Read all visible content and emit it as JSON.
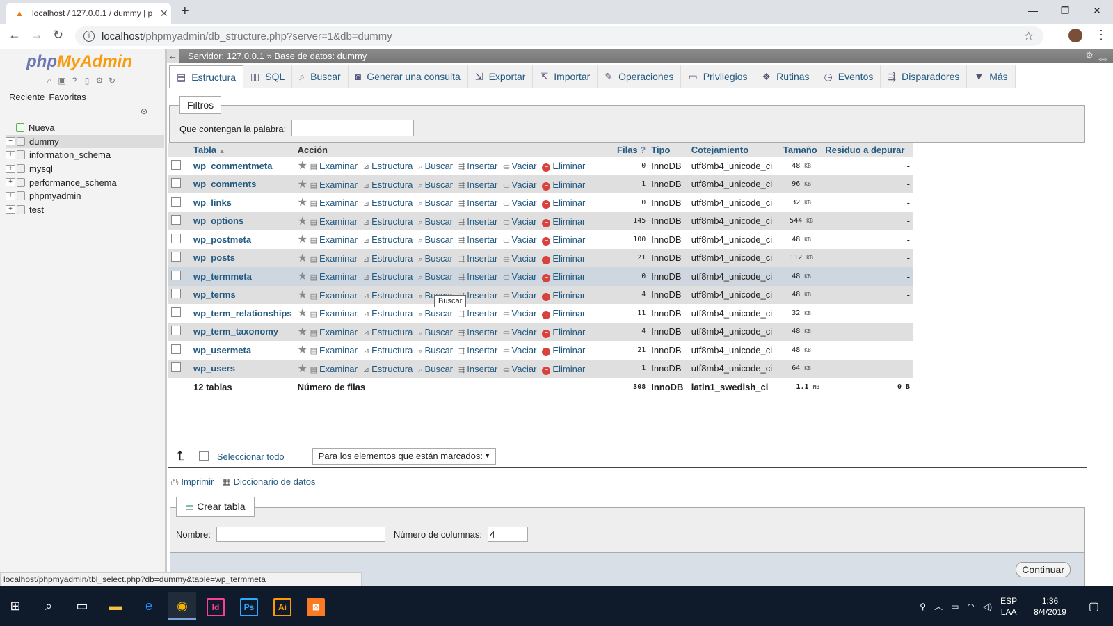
{
  "browser": {
    "tab_title": "localhost / 127.0.0.1 / dummy | p",
    "url_host": "localhost",
    "url_path": "/phpmyadmin/db_structure.php?server=1&db=dummy"
  },
  "sidebar": {
    "logo_php": "php",
    "logo_myadmin": "MyAdmin",
    "tabs": [
      "Reciente",
      "Favoritas"
    ],
    "tree": [
      {
        "label": "Nueva",
        "type": "new"
      },
      {
        "label": "dummy",
        "type": "db",
        "selected": true
      },
      {
        "label": "information_schema",
        "type": "db"
      },
      {
        "label": "mysql",
        "type": "db"
      },
      {
        "label": "performance_schema",
        "type": "db"
      },
      {
        "label": "phpmyadmin",
        "type": "db"
      },
      {
        "label": "test",
        "type": "db"
      }
    ]
  },
  "breadcrumb": {
    "server": "Servidor: 127.0.0.1 »",
    "database": "Base de datos: dummy"
  },
  "tabs": [
    {
      "label": "Estructura",
      "icon": "structure-icon",
      "active": true
    },
    {
      "label": "SQL",
      "icon": "sql-icon"
    },
    {
      "label": "Buscar",
      "icon": "search-icon"
    },
    {
      "label": "Generar una consulta",
      "icon": "query-icon"
    },
    {
      "label": "Exportar",
      "icon": "export-icon"
    },
    {
      "label": "Importar",
      "icon": "import-icon"
    },
    {
      "label": "Operaciones",
      "icon": "wrench-icon"
    },
    {
      "label": "Privilegios",
      "icon": "privileges-icon"
    },
    {
      "label": "Rutinas",
      "icon": "routines-icon"
    },
    {
      "label": "Eventos",
      "icon": "events-icon"
    },
    {
      "label": "Disparadores",
      "icon": "triggers-icon"
    },
    {
      "label": "Más",
      "icon": "more-icon"
    }
  ],
  "filters": {
    "legend": "Filtros",
    "label": "Que contengan la palabra:",
    "value": ""
  },
  "table": {
    "headers": {
      "tabla": "Tabla",
      "accion": "Acción",
      "filas": "Filas",
      "tipo": "Tipo",
      "cotejamiento": "Cotejamiento",
      "tamano": "Tamaño",
      "residuo": "Residuo a depurar"
    },
    "actions": [
      "Examinar",
      "Estructura",
      "Buscar",
      "Insertar",
      "Vaciar",
      "Eliminar"
    ],
    "rows": [
      {
        "name": "wp_commentmeta",
        "rows": "0",
        "type": "InnoDB",
        "collation": "utf8mb4_unicode_ci",
        "size": "48",
        "unit": "KB",
        "overhead": "-"
      },
      {
        "name": "wp_comments",
        "rows": "1",
        "type": "InnoDB",
        "collation": "utf8mb4_unicode_ci",
        "size": "96",
        "unit": "KB",
        "overhead": "-"
      },
      {
        "name": "wp_links",
        "rows": "0",
        "type": "InnoDB",
        "collation": "utf8mb4_unicode_ci",
        "size": "32",
        "unit": "KB",
        "overhead": "-"
      },
      {
        "name": "wp_options",
        "rows": "145",
        "type": "InnoDB",
        "collation": "utf8mb4_unicode_ci",
        "size": "544",
        "unit": "KB",
        "overhead": "-"
      },
      {
        "name": "wp_postmeta",
        "rows": "100",
        "type": "InnoDB",
        "collation": "utf8mb4_unicode_ci",
        "size": "48",
        "unit": "KB",
        "overhead": "-"
      },
      {
        "name": "wp_posts",
        "rows": "21",
        "type": "InnoDB",
        "collation": "utf8mb4_unicode_ci",
        "size": "112",
        "unit": "KB",
        "overhead": "-"
      },
      {
        "name": "wp_termmeta",
        "rows": "0",
        "type": "InnoDB",
        "collation": "utf8mb4_unicode_ci",
        "size": "48",
        "unit": "KB",
        "overhead": "-",
        "highlight": true
      },
      {
        "name": "wp_terms",
        "rows": "4",
        "type": "InnoDB",
        "collation": "utf8mb4_unicode_ci",
        "size": "48",
        "unit": "KB",
        "overhead": "-"
      },
      {
        "name": "wp_term_relationships",
        "rows": "11",
        "type": "InnoDB",
        "collation": "utf8mb4_unicode_ci",
        "size": "32",
        "unit": "KB",
        "overhead": "-"
      },
      {
        "name": "wp_term_taxonomy",
        "rows": "4",
        "type": "InnoDB",
        "collation": "utf8mb4_unicode_ci",
        "size": "48",
        "unit": "KB",
        "overhead": "-"
      },
      {
        "name": "wp_usermeta",
        "rows": "21",
        "type": "InnoDB",
        "collation": "utf8mb4_unicode_ci",
        "size": "48",
        "unit": "KB",
        "overhead": "-"
      },
      {
        "name": "wp_users",
        "rows": "1",
        "type": "InnoDB",
        "collation": "utf8mb4_unicode_ci",
        "size": "64",
        "unit": "KB",
        "overhead": "-"
      }
    ],
    "footer": {
      "count": "12 tablas",
      "label": "Número de filas",
      "rows": "308",
      "type": "InnoDB",
      "collation": "latin1_swedish_ci",
      "size": "1.1",
      "unit": "MB",
      "overhead": "0 B"
    }
  },
  "tooltip": "Buscar",
  "bulk": {
    "select_all": "Seleccionar todo",
    "dropdown": "Para los elementos que están marcados:"
  },
  "links": {
    "print": "Imprimir",
    "dictionary": "Diccionario de datos"
  },
  "create": {
    "legend": "Crear tabla",
    "name_label": "Nombre:",
    "name_value": "",
    "cols_label": "Número de columnas:",
    "cols_value": "4",
    "button": "Continuar"
  },
  "status_url": "localhost/phpmyadmin/tbl_select.php?db=dummy&table=wp_termmeta",
  "taskbar": {
    "lang_top": "ESP",
    "lang_bottom": "LAA",
    "time": "1:36",
    "date": "8/4/2019"
  }
}
